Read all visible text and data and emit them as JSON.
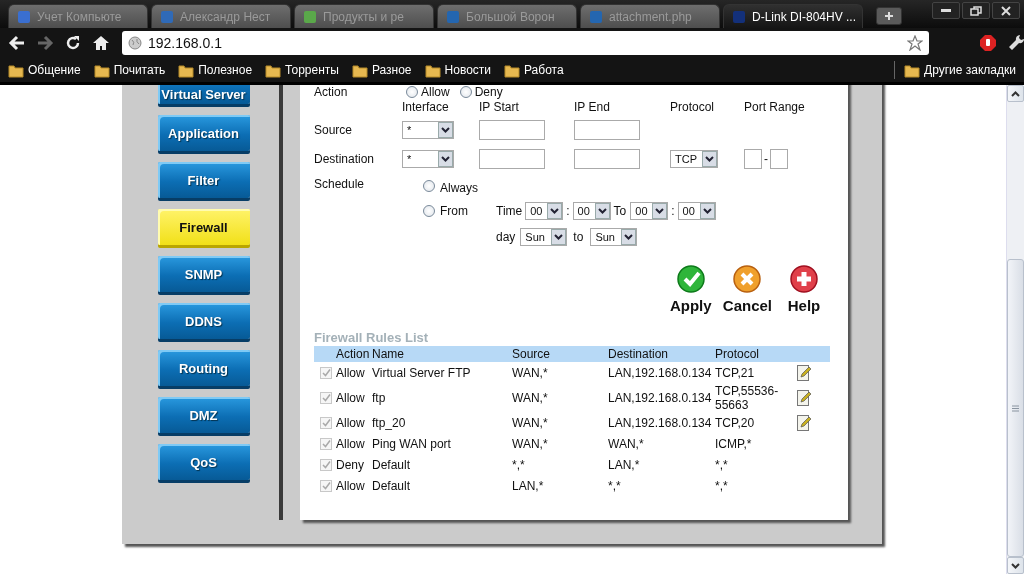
{
  "browser": {
    "tabs": [
      {
        "title": "Учет Компьюте",
        "selected": false
      },
      {
        "title": "Александр Нест",
        "selected": false
      },
      {
        "title": "Продукты и ре",
        "selected": false
      },
      {
        "title": "Большой Ворон",
        "selected": false
      },
      {
        "title": "attachment.php",
        "selected": false
      },
      {
        "title": "D-Link DI-804HV ...",
        "selected": true
      }
    ],
    "address": "192.168.0.1",
    "bookmarks": [
      "Общение",
      "Почитать",
      "Полезное",
      "Торренты",
      "Разное",
      "Новости",
      "Работа"
    ],
    "other_bookmarks": "Другие закладки"
  },
  "sidebar": {
    "items": [
      {
        "label": "Virtual Server",
        "selected": false
      },
      {
        "label": "Application",
        "selected": false
      },
      {
        "label": "Filter",
        "selected": false
      },
      {
        "label": "Firewall",
        "selected": true
      },
      {
        "label": "SNMP",
        "selected": false
      },
      {
        "label": "DDNS",
        "selected": false
      },
      {
        "label": "Routing",
        "selected": false
      },
      {
        "label": "DMZ",
        "selected": false
      },
      {
        "label": "QoS",
        "selected": false
      }
    ]
  },
  "form": {
    "action": {
      "label": "Action",
      "options": [
        {
          "label": "Allow",
          "selected": false
        },
        {
          "label": "Deny",
          "selected": false
        }
      ]
    },
    "columns": [
      "Interface",
      "IP Start",
      "IP End",
      "Protocol",
      "Port Range"
    ],
    "source": {
      "label": "Source",
      "interface": "*"
    },
    "destination": {
      "label": "Destination",
      "interface": "*",
      "protocol": "TCP",
      "port_separator": "-"
    },
    "schedule": {
      "label": "Schedule",
      "options": [
        {
          "label": "Always",
          "selected": false
        },
        {
          "label": "From",
          "selected": false
        }
      ],
      "time_label": "Time",
      "from_hour": "00",
      "from_separator": ":",
      "from_minute": "00",
      "to_label": "To",
      "to_hour": "00",
      "to_separator": ":",
      "to_minute": "00",
      "day_label": "day",
      "day_from": "Sun",
      "day_to_label": "to",
      "day_to": "Sun"
    }
  },
  "actions": [
    {
      "kind": "apply",
      "label": "Apply"
    },
    {
      "kind": "cancel",
      "label": "Cancel"
    },
    {
      "kind": "help",
      "label": "Help"
    }
  ],
  "rules": {
    "title": "Firewall Rules List",
    "columns": [
      "Action",
      "Name",
      "Source",
      "Destination",
      "Protocol"
    ],
    "rows": [
      {
        "checked": true,
        "action": "Allow",
        "name": "Virtual Server FTP",
        "source": "WAN,*",
        "destination": "LAN,192.168.0.134",
        "protocol": "TCP,21",
        "editable": true
      },
      {
        "checked": true,
        "action": "Allow",
        "name": "ftp",
        "source": "WAN,*",
        "destination": "LAN,192.168.0.134",
        "protocol": "TCP,55536-55663",
        "editable": true
      },
      {
        "checked": true,
        "action": "Allow",
        "name": "ftp_20",
        "source": "WAN,*",
        "destination": "LAN,192.168.0.134",
        "protocol": "TCP,20",
        "editable": true
      },
      {
        "checked": true,
        "action": "Allow",
        "name": "Ping WAN port",
        "source": "WAN,*",
        "destination": "WAN,*",
        "protocol": "ICMP,*",
        "editable": false
      },
      {
        "checked": true,
        "action": "Deny",
        "name": "Default",
        "source": "*,*",
        "destination": "LAN,*",
        "protocol": "*,*",
        "editable": false
      },
      {
        "checked": true,
        "action": "Allow",
        "name": "Default",
        "source": "LAN,*",
        "destination": "*,*",
        "protocol": "*,*",
        "editable": false
      }
    ]
  }
}
